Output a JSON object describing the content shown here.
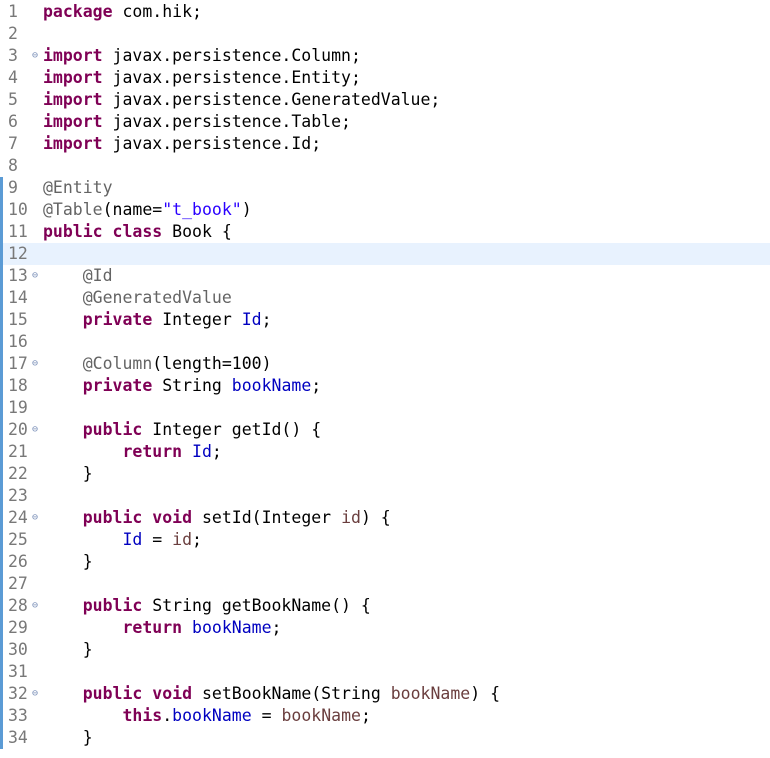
{
  "editor": {
    "language": "java",
    "current_line": 12,
    "colors": {
      "keyword": "#7f0055",
      "annotation": "#646464",
      "field": "#0000c0",
      "string": "#2a00ff",
      "local_variable": "#6a3e3e",
      "line_number": "#787878",
      "current_line_bg": "#e8f2fe",
      "change_ruler": "#5b9bd5"
    },
    "lines": [
      {
        "n": "1",
        "fold": false,
        "changed": false,
        "tokens": [
          {
            "t": "package",
            "c": "kw"
          },
          {
            "t": " com.hik;",
            "c": "tx"
          }
        ]
      },
      {
        "n": "2",
        "fold": false,
        "changed": false,
        "tokens": []
      },
      {
        "n": "3",
        "fold": true,
        "changed": false,
        "tokens": [
          {
            "t": "import",
            "c": "kw"
          },
          {
            "t": " javax.persistence.Column;",
            "c": "tx"
          }
        ]
      },
      {
        "n": "4",
        "fold": false,
        "changed": false,
        "tokens": [
          {
            "t": "import",
            "c": "kw"
          },
          {
            "t": " javax.persistence.Entity;",
            "c": "tx"
          }
        ]
      },
      {
        "n": "5",
        "fold": false,
        "changed": false,
        "tokens": [
          {
            "t": "import",
            "c": "kw"
          },
          {
            "t": " javax.persistence.GeneratedValue;",
            "c": "tx"
          }
        ]
      },
      {
        "n": "6",
        "fold": false,
        "changed": false,
        "tokens": [
          {
            "t": "import",
            "c": "kw"
          },
          {
            "t": " javax.persistence.Table;",
            "c": "tx"
          }
        ]
      },
      {
        "n": "7",
        "fold": false,
        "changed": false,
        "tokens": [
          {
            "t": "import",
            "c": "kw"
          },
          {
            "t": " javax.persistence.Id;",
            "c": "tx"
          }
        ]
      },
      {
        "n": "8",
        "fold": false,
        "changed": false,
        "tokens": []
      },
      {
        "n": "9",
        "fold": false,
        "changed": true,
        "tokens": [
          {
            "t": "@Entity",
            "c": "ann"
          }
        ]
      },
      {
        "n": "10",
        "fold": false,
        "changed": true,
        "tokens": [
          {
            "t": "@Table",
            "c": "ann"
          },
          {
            "t": "(name=",
            "c": "tx"
          },
          {
            "t": "\"t_book\"",
            "c": "str"
          },
          {
            "t": ")",
            "c": "tx"
          }
        ]
      },
      {
        "n": "11",
        "fold": false,
        "changed": true,
        "tokens": [
          {
            "t": "public",
            "c": "kw"
          },
          {
            "t": " ",
            "c": "tx"
          },
          {
            "t": "class",
            "c": "kw"
          },
          {
            "t": " Book {",
            "c": "tx"
          }
        ]
      },
      {
        "n": "12",
        "fold": false,
        "changed": true,
        "tokens": []
      },
      {
        "n": "13",
        "fold": true,
        "changed": true,
        "tokens": [
          {
            "t": "    ",
            "c": "tx"
          },
          {
            "t": "@Id",
            "c": "ann"
          }
        ]
      },
      {
        "n": "14",
        "fold": false,
        "changed": true,
        "tokens": [
          {
            "t": "    ",
            "c": "tx"
          },
          {
            "t": "@GeneratedValue",
            "c": "ann"
          }
        ]
      },
      {
        "n": "15",
        "fold": false,
        "changed": true,
        "tokens": [
          {
            "t": "    ",
            "c": "tx"
          },
          {
            "t": "private",
            "c": "kw"
          },
          {
            "t": " Integer ",
            "c": "tx"
          },
          {
            "t": "Id",
            "c": "fld"
          },
          {
            "t": ";",
            "c": "tx"
          }
        ]
      },
      {
        "n": "16",
        "fold": false,
        "changed": true,
        "tokens": []
      },
      {
        "n": "17",
        "fold": true,
        "changed": true,
        "tokens": [
          {
            "t": "    ",
            "c": "tx"
          },
          {
            "t": "@Column",
            "c": "ann"
          },
          {
            "t": "(length=100)",
            "c": "tx"
          }
        ]
      },
      {
        "n": "18",
        "fold": false,
        "changed": true,
        "tokens": [
          {
            "t": "    ",
            "c": "tx"
          },
          {
            "t": "private",
            "c": "kw"
          },
          {
            "t": " String ",
            "c": "tx"
          },
          {
            "t": "bookName",
            "c": "fld"
          },
          {
            "t": ";",
            "c": "tx"
          }
        ]
      },
      {
        "n": "19",
        "fold": false,
        "changed": true,
        "tokens": []
      },
      {
        "n": "20",
        "fold": true,
        "changed": true,
        "tokens": [
          {
            "t": "    ",
            "c": "tx"
          },
          {
            "t": "public",
            "c": "kw"
          },
          {
            "t": " Integer getId() {",
            "c": "tx"
          }
        ]
      },
      {
        "n": "21",
        "fold": false,
        "changed": true,
        "tokens": [
          {
            "t": "        ",
            "c": "tx"
          },
          {
            "t": "return",
            "c": "kw"
          },
          {
            "t": " ",
            "c": "tx"
          },
          {
            "t": "Id",
            "c": "fld"
          },
          {
            "t": ";",
            "c": "tx"
          }
        ]
      },
      {
        "n": "22",
        "fold": false,
        "changed": true,
        "tokens": [
          {
            "t": "    }",
            "c": "tx"
          }
        ]
      },
      {
        "n": "23",
        "fold": false,
        "changed": true,
        "tokens": []
      },
      {
        "n": "24",
        "fold": true,
        "changed": true,
        "tokens": [
          {
            "t": "    ",
            "c": "tx"
          },
          {
            "t": "public",
            "c": "kw"
          },
          {
            "t": " ",
            "c": "tx"
          },
          {
            "t": "void",
            "c": "kw"
          },
          {
            "t": " setId(Integer ",
            "c": "tx"
          },
          {
            "t": "id",
            "c": "lv"
          },
          {
            "t": ") {",
            "c": "tx"
          }
        ]
      },
      {
        "n": "25",
        "fold": false,
        "changed": true,
        "tokens": [
          {
            "t": "        ",
            "c": "tx"
          },
          {
            "t": "Id",
            "c": "fld"
          },
          {
            "t": " = ",
            "c": "tx"
          },
          {
            "t": "id",
            "c": "lv"
          },
          {
            "t": ";",
            "c": "tx"
          }
        ]
      },
      {
        "n": "26",
        "fold": false,
        "changed": true,
        "tokens": [
          {
            "t": "    }",
            "c": "tx"
          }
        ]
      },
      {
        "n": "27",
        "fold": false,
        "changed": true,
        "tokens": []
      },
      {
        "n": "28",
        "fold": true,
        "changed": true,
        "tokens": [
          {
            "t": "    ",
            "c": "tx"
          },
          {
            "t": "public",
            "c": "kw"
          },
          {
            "t": " String getBookName() {",
            "c": "tx"
          }
        ]
      },
      {
        "n": "29",
        "fold": false,
        "changed": true,
        "tokens": [
          {
            "t": "        ",
            "c": "tx"
          },
          {
            "t": "return",
            "c": "kw"
          },
          {
            "t": " ",
            "c": "tx"
          },
          {
            "t": "bookName",
            "c": "fld"
          },
          {
            "t": ";",
            "c": "tx"
          }
        ]
      },
      {
        "n": "30",
        "fold": false,
        "changed": true,
        "tokens": [
          {
            "t": "    }",
            "c": "tx"
          }
        ]
      },
      {
        "n": "31",
        "fold": false,
        "changed": true,
        "tokens": []
      },
      {
        "n": "32",
        "fold": true,
        "changed": true,
        "tokens": [
          {
            "t": "    ",
            "c": "tx"
          },
          {
            "t": "public",
            "c": "kw"
          },
          {
            "t": " ",
            "c": "tx"
          },
          {
            "t": "void",
            "c": "kw"
          },
          {
            "t": " setBookName(String ",
            "c": "tx"
          },
          {
            "t": "bookName",
            "c": "lv"
          },
          {
            "t": ") {",
            "c": "tx"
          }
        ]
      },
      {
        "n": "33",
        "fold": false,
        "changed": true,
        "tokens": [
          {
            "t": "        ",
            "c": "tx"
          },
          {
            "t": "this",
            "c": "kw"
          },
          {
            "t": ".",
            "c": "tx"
          },
          {
            "t": "bookName",
            "c": "fld"
          },
          {
            "t": " = ",
            "c": "tx"
          },
          {
            "t": "bookName",
            "c": "lv"
          },
          {
            "t": ";",
            "c": "tx"
          }
        ]
      },
      {
        "n": "34",
        "fold": false,
        "changed": true,
        "tokens": [
          {
            "t": "    }",
            "c": "tx"
          }
        ]
      }
    ]
  }
}
